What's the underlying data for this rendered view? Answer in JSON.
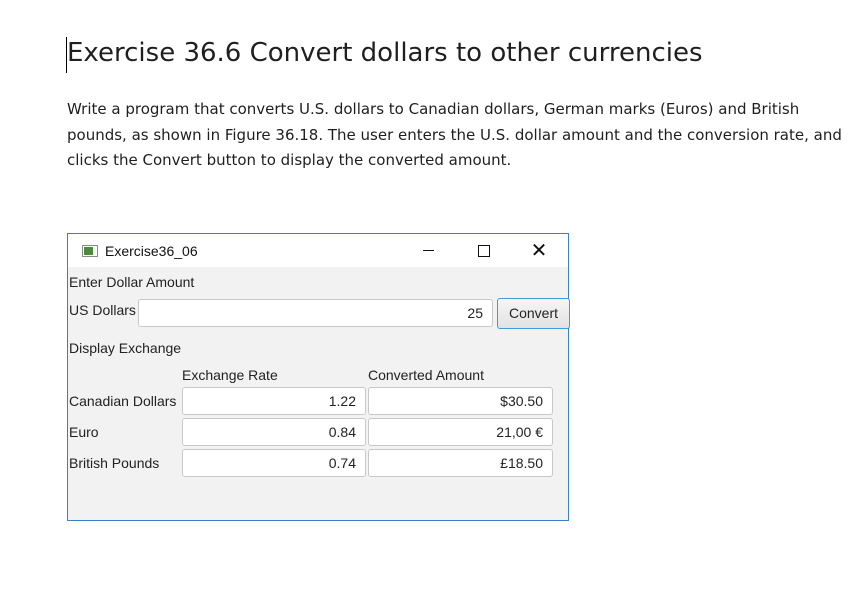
{
  "document": {
    "title": "Exercise 36.6  Convert dollars to other currencies",
    "paragraph": "Write a program that converts U.S. dollars to Canadian dollars, German marks (Euros) and British pounds, as shown in Figure 36.18.  The user enters the U.S. dollar amount and the conversion rate, and clicks the Convert button to display the converted amount."
  },
  "window": {
    "title": "Exercise36_06",
    "minimize_glyph": "",
    "maximize_glyph": "",
    "close_glyph": "✕"
  },
  "input_section": {
    "heading": "Enter Dollar Amount",
    "us_dollars_label": "US Dollars",
    "us_dollars_value": "25",
    "convert_label": "Convert"
  },
  "exchange_section": {
    "heading": "Display Exchange",
    "rate_header": "Exchange Rate",
    "converted_header": "Converted Amount",
    "rows": [
      {
        "currency": "Canadian Dollars",
        "rate": "1.22",
        "converted": "$30.50"
      },
      {
        "currency": "Euro",
        "rate": "0.84",
        "converted": "21,00 €"
      },
      {
        "currency": "British Pounds",
        "rate": "0.74",
        "converted": "£18.50"
      }
    ]
  }
}
